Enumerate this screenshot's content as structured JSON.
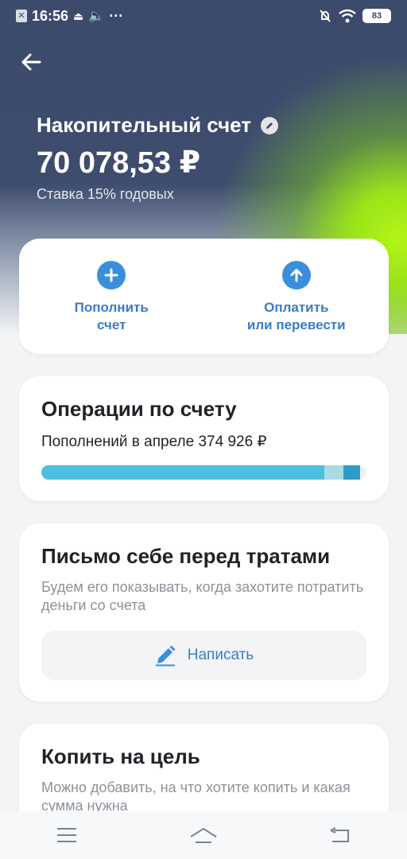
{
  "status_bar": {
    "time": "16:56",
    "dots": "···",
    "battery": "83"
  },
  "account": {
    "title": "Накопительный счет",
    "balance": "70 078,53 ₽",
    "rate": "Ставка 15% годовых"
  },
  "actions": [
    {
      "label_line1": "Пополнить",
      "label_line2": "счет",
      "icon": "plus-icon"
    },
    {
      "label_line1": "Оплатить",
      "label_line2": "или перевести",
      "icon": "arrow-up-icon"
    }
  ],
  "operations": {
    "title": "Операции по счету",
    "summary": "Пополнений в апреле 374 926 ₽",
    "bar_fractions": [
      0.87,
      0.06,
      0.05
    ]
  },
  "letter": {
    "title": "Письмо себе перед тратами",
    "description": "Будем его показывать, когда захотите потратить деньги со счета",
    "button_label": "Написать"
  },
  "goal": {
    "title": "Копить на цель",
    "description": "Можно добавить, на что хотите копить и какая сумма нужна"
  },
  "colors": {
    "hero_bg": "#3c4a6c",
    "accent_green": "#b4f516",
    "accent_blue": "#3a8fdc"
  }
}
